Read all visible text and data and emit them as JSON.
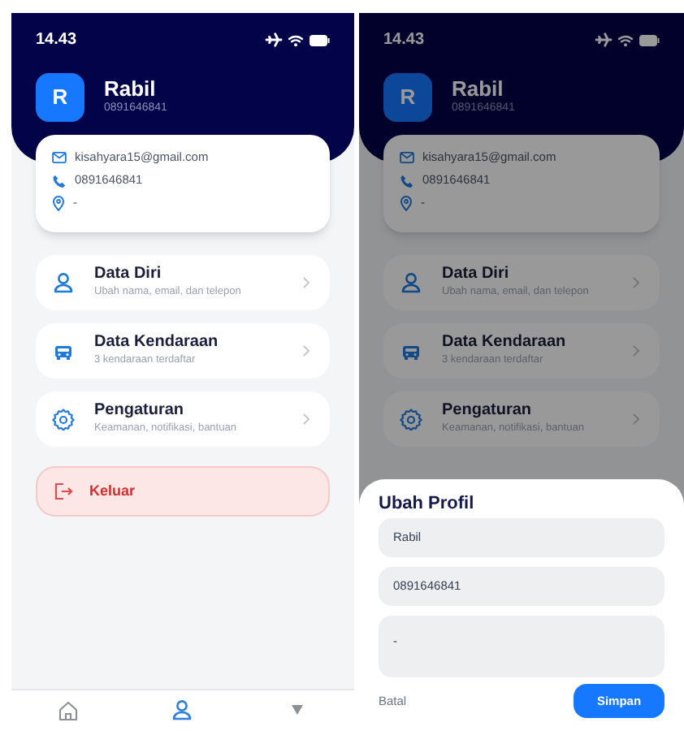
{
  "screens": [
    {
      "status_bar": {
        "time": "14.43"
      },
      "profile": {
        "initial": "R",
        "name": "Rabil",
        "phone": "0891646841"
      },
      "contact": {
        "email": "kisahyara15@gmail.com",
        "phone": "0891646841",
        "address": "-"
      },
      "menu": [
        {
          "title": "Data Diri",
          "subtitle": "Ubah nama, email, dan telepon"
        },
        {
          "title": "Data Kendaraan",
          "subtitle": "3 kendaraan terdaftar"
        },
        {
          "title": "Pengaturan",
          "subtitle": "Keamanan, notifikasi, bantuan"
        }
      ],
      "logout": {
        "label": "Keluar"
      },
      "nav": [
        {
          "selected": false
        },
        {
          "selected": true
        },
        {
          "selected": false
        }
      ],
      "dimmed": false
    },
    {
      "status_bar": {
        "time": "14.43"
      },
      "profile": {
        "initial": "R",
        "name": "Rabil",
        "phone": "0891646841"
      },
      "contact": {
        "email": "kisahyara15@gmail.com",
        "phone": "0891646841",
        "address": "-"
      },
      "menu": [
        {
          "title": "Data Diri",
          "subtitle": "Ubah nama, email, dan telepon"
        },
        {
          "title": "Data Kendaraan",
          "subtitle": "3 kendaraan terdaftar"
        },
        {
          "title": "Pengaturan",
          "subtitle": "Keamanan, notifikasi, bantuan"
        }
      ],
      "dimmed": true,
      "sheet": {
        "title": "Ubah Profil",
        "fields": [
          {
            "kind": "text",
            "value": "Rabil"
          },
          {
            "kind": "text",
            "value": "0891646841"
          },
          {
            "kind": "textarea",
            "value": "-"
          }
        ],
        "cancel": "Batal",
        "save": "Simpan"
      }
    }
  ]
}
